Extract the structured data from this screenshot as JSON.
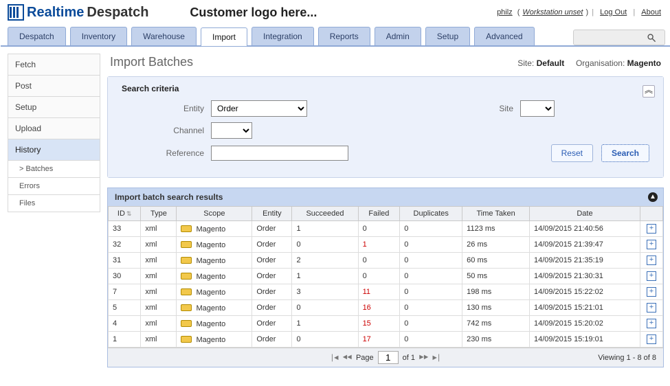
{
  "brand": {
    "part1": "Realtime",
    "part2": "Despatch"
  },
  "customer_logo_text": "Customer logo here...",
  "toplinks": {
    "user": "philz",
    "workstation": "Workstation unset",
    "logout": "Log Out",
    "about": "About"
  },
  "tabs": [
    "Despatch",
    "Inventory",
    "Warehouse",
    "Import",
    "Integration",
    "Reports",
    "Admin",
    "Setup",
    "Advanced"
  ],
  "active_tab": "Import",
  "global_search_placeholder": "",
  "sidebar": {
    "items": [
      "Fetch",
      "Post",
      "Setup",
      "Upload",
      "History"
    ],
    "active": "History",
    "subitems": [
      "Batches",
      "Errors",
      "Files"
    ],
    "current_sub": "Batches"
  },
  "page": {
    "title": "Import Batches",
    "site_label": "Site:",
    "site_value": "Default",
    "org_label": "Organisation:",
    "org_value": "Magento"
  },
  "criteria": {
    "legend": "Search criteria",
    "entity_label": "Entity",
    "entity_value": "Order",
    "site_label": "Site",
    "site_value": "",
    "channel_label": "Channel",
    "channel_value": "",
    "reference_label": "Reference",
    "reference_value": "",
    "reset": "Reset",
    "search": "Search"
  },
  "results": {
    "header": "Import batch search results",
    "columns": [
      "ID",
      "Type",
      "Scope",
      "Entity",
      "Succeeded",
      "Failed",
      "Duplicates",
      "Time Taken",
      "Date"
    ],
    "rows": [
      {
        "id": "33",
        "type": "xml",
        "scope": "Magento",
        "entity": "Order",
        "succeeded": "1",
        "failed": "0",
        "duplicates": "0",
        "time": "1123 ms",
        "date": "14/09/2015 21:40:56"
      },
      {
        "id": "32",
        "type": "xml",
        "scope": "Magento",
        "entity": "Order",
        "succeeded": "0",
        "failed": "1",
        "failed_red": true,
        "duplicates": "0",
        "time": "26 ms",
        "date": "14/09/2015 21:39:47"
      },
      {
        "id": "31",
        "type": "xml",
        "scope": "Magento",
        "entity": "Order",
        "succeeded": "2",
        "failed": "0",
        "duplicates": "0",
        "time": "60 ms",
        "date": "14/09/2015 21:35:19"
      },
      {
        "id": "30",
        "type": "xml",
        "scope": "Magento",
        "entity": "Order",
        "succeeded": "1",
        "failed": "0",
        "duplicates": "0",
        "time": "50 ms",
        "date": "14/09/2015 21:30:31"
      },
      {
        "id": "7",
        "type": "xml",
        "scope": "Magento",
        "entity": "Order",
        "succeeded": "3",
        "failed": "11",
        "failed_red": true,
        "duplicates": "0",
        "time": "198 ms",
        "date": "14/09/2015 15:22:02"
      },
      {
        "id": "5",
        "type": "xml",
        "scope": "Magento",
        "entity": "Order",
        "succeeded": "0",
        "failed": "16",
        "failed_red": true,
        "duplicates": "0",
        "time": "130 ms",
        "date": "14/09/2015 15:21:01"
      },
      {
        "id": "4",
        "type": "xml",
        "scope": "Magento",
        "entity": "Order",
        "succeeded": "1",
        "failed": "15",
        "failed_red": true,
        "duplicates": "0",
        "time": "742 ms",
        "date": "14/09/2015 15:20:02"
      },
      {
        "id": "1",
        "type": "xml",
        "scope": "Magento",
        "entity": "Order",
        "succeeded": "0",
        "failed": "17",
        "failed_red": true,
        "duplicates": "0",
        "time": "230 ms",
        "date": "14/09/2015 15:19:01"
      }
    ],
    "pager": {
      "page_label_pre": "Page",
      "page_value": "1",
      "page_label_post": "of 1",
      "viewing": "Viewing 1 - 8 of 8"
    }
  }
}
